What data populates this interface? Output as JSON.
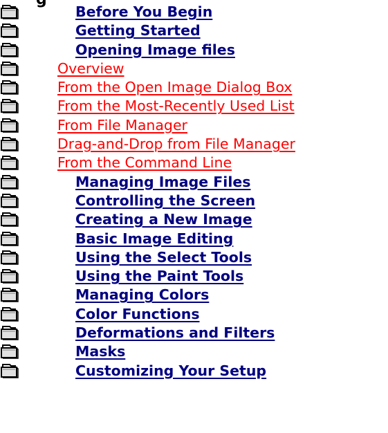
{
  "page": {
    "title_fragment": "g",
    "colors": {
      "background": "#ffffff",
      "chapter_link": "#000080",
      "subtopic_link": "#ff0000",
      "icon_outline": "#000000",
      "icon_fill": "#e0e0e0"
    }
  },
  "topics": [
    {
      "label": "Before You Begin",
      "level": 1,
      "icon": "closed-book-icon"
    },
    {
      "label": "Getting Started",
      "level": 1,
      "icon": "closed-book-icon"
    },
    {
      "label": "Opening Image files",
      "level": 1,
      "icon": "closed-book-icon"
    },
    {
      "label": "Overview",
      "level": 2,
      "icon": "closed-book-icon"
    },
    {
      "label": "From the Open Image Dialog Box",
      "level": 2,
      "icon": "closed-book-icon"
    },
    {
      "label": "From the Most-Recently Used List",
      "level": 2,
      "icon": "closed-book-icon"
    },
    {
      "label": "From File Manager",
      "level": 2,
      "icon": "closed-book-icon"
    },
    {
      "label": "Drag-and-Drop from File Manager",
      "level": 2,
      "icon": "closed-book-icon"
    },
    {
      "label": "From the Command Line",
      "level": 2,
      "icon": "closed-book-icon"
    },
    {
      "label": "Managing Image Files",
      "level": 1,
      "icon": "closed-book-icon"
    },
    {
      "label": "Controlling the Screen",
      "level": 1,
      "icon": "closed-book-icon"
    },
    {
      "label": "Creating a New Image",
      "level": 1,
      "icon": "closed-book-icon"
    },
    {
      "label": "Basic Image Editing",
      "level": 1,
      "icon": "closed-book-icon"
    },
    {
      "label": "Using the Select Tools",
      "level": 1,
      "icon": "closed-book-icon"
    },
    {
      "label": "Using the Paint Tools",
      "level": 1,
      "icon": "closed-book-icon"
    },
    {
      "label": "Managing Colors",
      "level": 1,
      "icon": "closed-book-icon"
    },
    {
      "label": "Color Functions",
      "level": 1,
      "icon": "closed-book-icon"
    },
    {
      "label": "Deformations and Filters",
      "level": 1,
      "icon": "closed-book-icon"
    },
    {
      "label": "Masks",
      "level": 1,
      "icon": "closed-book-icon"
    },
    {
      "label": "Customizing Your Setup",
      "level": 1,
      "icon": "closed-book-icon"
    }
  ]
}
